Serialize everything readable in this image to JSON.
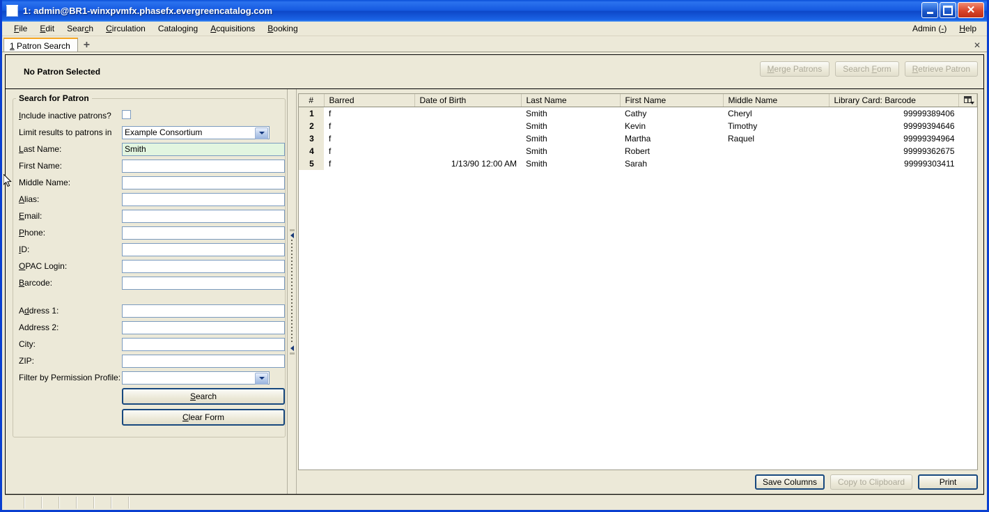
{
  "window": {
    "title": "1: admin@BR1-winxpvmfx.phasefx.evergreencatalog.com",
    "icon": "window-icon",
    "minimize": "_",
    "maximize": "□",
    "close": "✕"
  },
  "menubar": {
    "items": [
      {
        "label": "File",
        "accel": "F"
      },
      {
        "label": "Edit",
        "accel": "E"
      },
      {
        "label": "Search",
        "accel": "c"
      },
      {
        "label": "Circulation",
        "accel": "C"
      },
      {
        "label": "Cataloging",
        "accel": "g"
      },
      {
        "label": "Acquisitions",
        "accel": "A"
      },
      {
        "label": "Booking",
        "accel": "B"
      }
    ],
    "right_items": [
      {
        "label": "Admin (-)",
        "accel": "-"
      },
      {
        "label": "Help",
        "accel": "H"
      }
    ]
  },
  "tabs": {
    "items": [
      {
        "index": "1",
        "label": "Patron Search"
      }
    ],
    "add_label": "+",
    "close_label": "✕"
  },
  "patron_header": {
    "title": "No Patron Selected",
    "buttons": [
      {
        "label": "Merge Patrons",
        "accel_pre": "M",
        "accel_post": "erge Patrons",
        "disabled": true
      },
      {
        "label": "Search Form",
        "accel_pre": "",
        "accel_post": "",
        "disabled": true
      },
      {
        "label": "Retrieve Patron",
        "accel_pre": "R",
        "accel_post": "etrieve Patron",
        "disabled": true
      }
    ],
    "merge_patrons": {
      "pre": "M",
      "post": "erge Patrons"
    },
    "search_form": {
      "a": "Search ",
      "acc": "F",
      "b": "orm"
    },
    "retrieve_patron": {
      "pre": "R",
      "post": "etrieve Patron"
    }
  },
  "search_form": {
    "legend": "Search for Patron",
    "include_inactive": {
      "label_acc": "I",
      "label_rest": "nclude inactive patrons?",
      "checked": false
    },
    "limit_results": {
      "label": "Limit results to patrons in",
      "value": "Example Consortium"
    },
    "fields": [
      {
        "name": "last-name",
        "acc": "L",
        "rest": "ast Name:",
        "value": "Smith",
        "active": true
      },
      {
        "name": "first-name",
        "acc": "",
        "rest": "First Name:",
        "value": "",
        "active": false
      },
      {
        "name": "middle-name",
        "acc": "",
        "rest": "Middle Name:",
        "value": "",
        "active": false
      },
      {
        "name": "alias",
        "acc": "A",
        "rest": "lias:",
        "value": "",
        "active": false
      },
      {
        "name": "email",
        "acc": "E",
        "rest": "mail:",
        "value": "",
        "active": false
      },
      {
        "name": "phone",
        "acc": "P",
        "rest": "hone:",
        "value": "",
        "active": false
      },
      {
        "name": "id",
        "acc": "I",
        "rest": "D:",
        "value": "",
        "active": false
      },
      {
        "name": "opac-login",
        "acc": "O",
        "rest": "PAC Login:",
        "value": "",
        "active": false
      },
      {
        "name": "barcode",
        "acc": "B",
        "rest": "arcode:",
        "value": "",
        "active": false
      }
    ],
    "address_fields": [
      {
        "name": "address-1",
        "acc": "A",
        "rest": "ddress 1:",
        "value": ""
      },
      {
        "name": "address-2",
        "acc": "",
        "rest": "Address 2:",
        "value": ""
      },
      {
        "name": "city",
        "acc": "",
        "rest": "City:",
        "value": ""
      },
      {
        "name": "zip",
        "acc": "",
        "rest": "ZIP:",
        "value": ""
      }
    ],
    "permission_profile": {
      "label": "Filter by Permission Profile:",
      "value": ""
    },
    "search_button": {
      "acc": "S",
      "rest": "earch"
    },
    "clear_button": {
      "acc": "C",
      "rest": "lear Form"
    }
  },
  "results": {
    "columns": [
      {
        "key": "num",
        "label": "#",
        "align": "center"
      },
      {
        "key": "barred",
        "label": "Barred",
        "align": "left"
      },
      {
        "key": "dob",
        "label": "Date of Birth",
        "align": "right"
      },
      {
        "key": "last",
        "label": "Last Name",
        "align": "left"
      },
      {
        "key": "first",
        "label": "First Name",
        "align": "left"
      },
      {
        "key": "middle",
        "label": "Middle Name",
        "align": "left"
      },
      {
        "key": "barcode",
        "label": "Library Card: Barcode",
        "align": "right"
      }
    ],
    "column_picker_icon": "column-picker-icon",
    "rows": [
      {
        "num": "1",
        "barred": "f",
        "dob": "",
        "last": "Smith",
        "first": "Cathy",
        "middle": "Cheryl",
        "barcode": "99999389406"
      },
      {
        "num": "2",
        "barred": "f",
        "dob": "",
        "last": "Smith",
        "first": "Kevin",
        "middle": "Timothy",
        "barcode": "99999394646"
      },
      {
        "num": "3",
        "barred": "f",
        "dob": "",
        "last": "Smith",
        "first": "Martha",
        "middle": "Raquel",
        "barcode": "99999394964"
      },
      {
        "num": "4",
        "barred": "f",
        "dob": "",
        "last": "Smith",
        "first": "Robert",
        "middle": "",
        "barcode": "99999362675"
      },
      {
        "num": "5",
        "barred": "f",
        "dob": "1/13/90 12:00 AM",
        "last": "Smith",
        "first": "Sarah",
        "middle": "",
        "barcode": "99999303411"
      }
    ],
    "footer_buttons": {
      "save_columns": "Save Columns",
      "copy_clipboard": "Copy to Clipboard",
      "print": "Print"
    }
  },
  "colors": {
    "titlebar": "#1559e0",
    "chrome": "#ece9d8",
    "active_field": "#e2f5e0",
    "tab_accent": "#f5a623",
    "default_border": "#17487e"
  }
}
